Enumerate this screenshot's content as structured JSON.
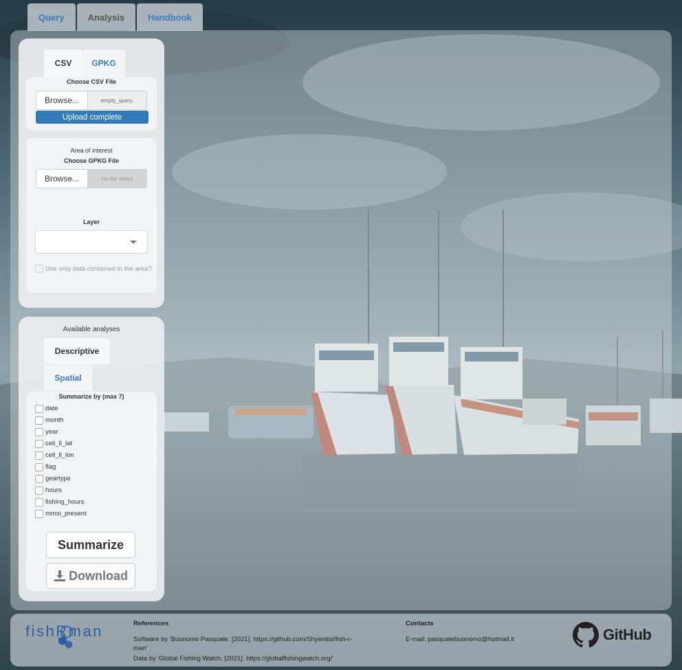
{
  "nav": {
    "tabs": [
      {
        "label": "Query",
        "active": false
      },
      {
        "label": "Analysis",
        "active": true
      },
      {
        "label": "Handbook",
        "active": false
      }
    ]
  },
  "sidebar": {
    "file_tabs": [
      {
        "label": "CSV",
        "active": true
      },
      {
        "label": "GPKG",
        "active": false
      }
    ],
    "csv": {
      "label": "Choose CSV File",
      "browse_label": "Browse...",
      "file_name": "empty_query.",
      "progress_label": "Upload complete",
      "progress_fraction": 1
    },
    "aoi": {
      "title": "Area of interest",
      "gpkg_label": "Choose GPKG File",
      "browse_label": "Browse...",
      "file_name": "No file select",
      "layer_label": "Layer",
      "layer_value": "",
      "checkbox_label": "Use only data contained in the area?"
    },
    "analyses": {
      "title": "Available analyses",
      "tabs": [
        {
          "label": "Descriptive",
          "active": true
        },
        {
          "label": "Spatial",
          "active": false
        }
      ],
      "summarize_label": "Summarize by (max 7)",
      "options": [
        "date",
        "month",
        "year",
        "cell_ll_lat",
        "cell_ll_lon",
        "flag",
        "geartype",
        "hours",
        "fishing_hours",
        "mmsi_present"
      ],
      "summarize_button": "Summarize",
      "download_button": "Download"
    }
  },
  "footer": {
    "logo_text": "fishRman",
    "references": {
      "title": "References",
      "line1": "Software by 'Buonomo Pasquale. [2021]. https://github.com/Shyentist/fish-r-",
      "line2": "man'",
      "line3": "Data by 'Global Fishing Watch. [2021]. https://globalfishingwatch.org/'"
    },
    "contacts": {
      "title": "Contacts",
      "email": "E-mail: pasqualebuonomo@hotmail.it"
    },
    "github_label": "GitHub"
  },
  "colors": {
    "accent": "#337ab7",
    "link": "#3a7bc0"
  }
}
